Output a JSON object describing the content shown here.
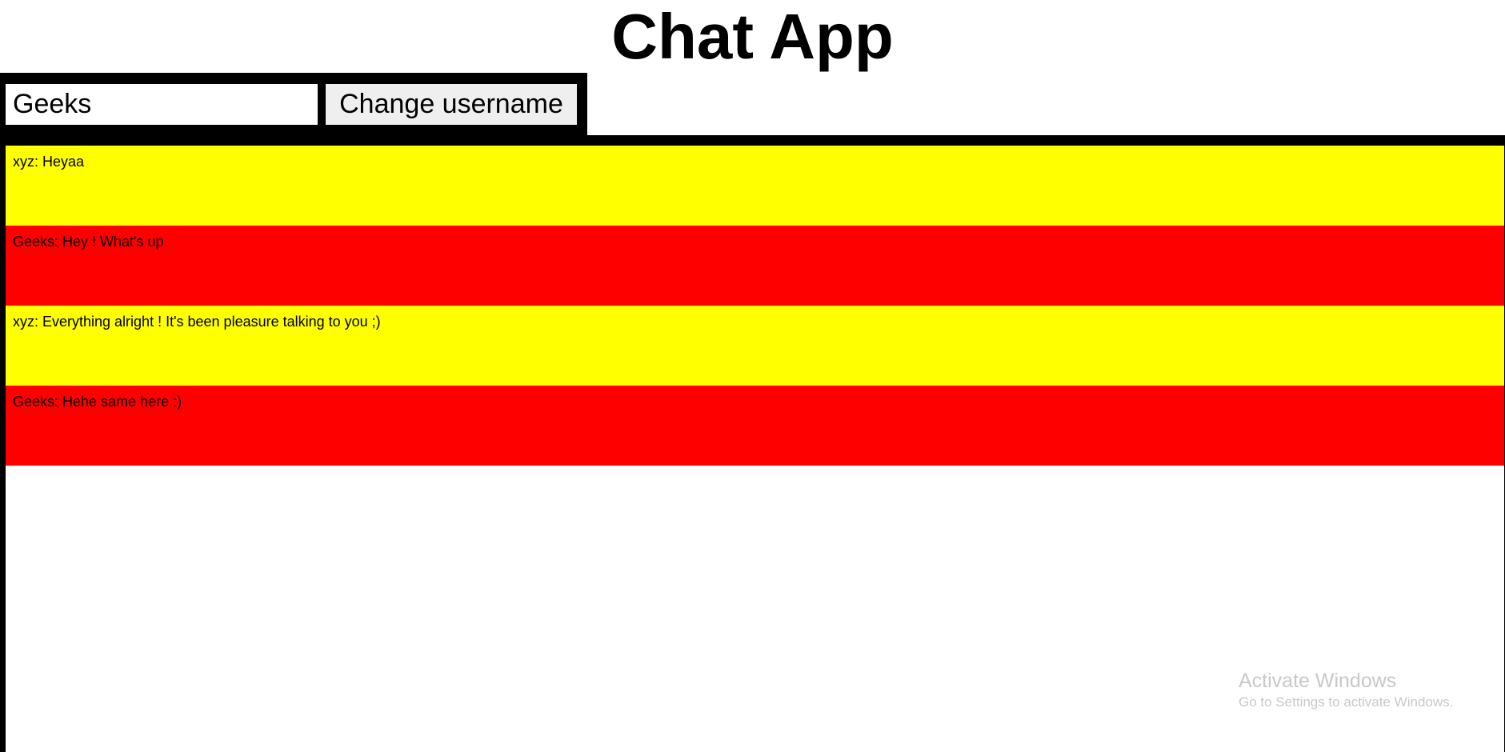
{
  "header": {
    "title": "Chat App"
  },
  "toolbar": {
    "username_value": "Geeks",
    "change_username_label": "Change username"
  },
  "messages": [
    {
      "text": "xyz: Heyaa",
      "color": "#ffff00"
    },
    {
      "text": "Geeks: Hey ! What's up",
      "color": "#ff0000"
    },
    {
      "text": "xyz: Everything alright ! It's been pleasure talking to you ;)",
      "color": "#ffff00"
    },
    {
      "text": "Geeks: Hehe same here :)",
      "color": "#ff0000"
    }
  ],
  "watermark": {
    "title": "Activate Windows",
    "subtitle": "Go to Settings to activate Windows."
  }
}
